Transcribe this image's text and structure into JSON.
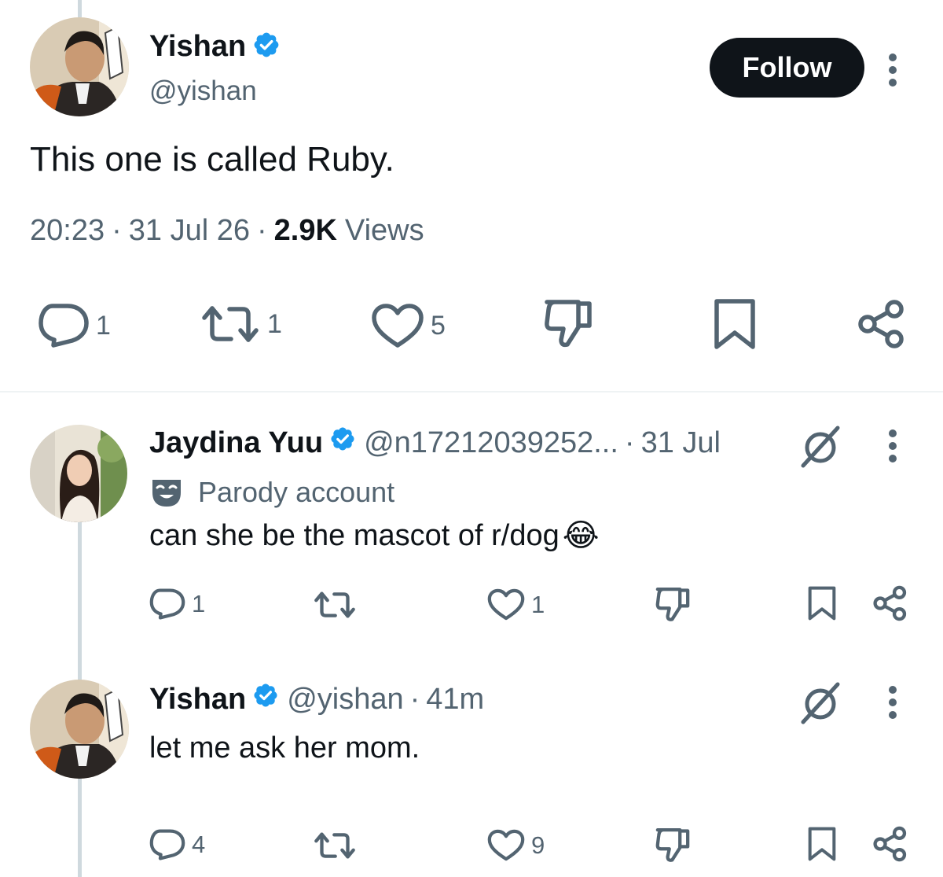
{
  "main_tweet": {
    "display_name": "Yishan",
    "handle": "@yishan",
    "follow_label": "Follow",
    "text": "This one is called Ruby.",
    "time": "20:23",
    "sep1": "·",
    "date": "31 Jul 26",
    "sep2": "·",
    "views_count": "2.9K",
    "views_label": "Views",
    "actions": {
      "replies": "1",
      "reposts": "1",
      "likes": "5"
    }
  },
  "replies": [
    {
      "display_name": "Jaydina Yuu",
      "handle": "@n17212039252...",
      "sep": "·",
      "time": "31 Jul",
      "badge_label": "Parody account",
      "text": "can she be the mascot of r/dog",
      "emoji": "😂",
      "actions": {
        "replies": "1",
        "reposts": "",
        "likes": "1"
      }
    },
    {
      "display_name": "Yishan",
      "handle": "@yishan",
      "sep": "·",
      "time": "41m",
      "text": "let me ask her mom.",
      "actions": {
        "replies": "4",
        "reposts": "",
        "likes": "9"
      }
    }
  ],
  "colors": {
    "text": "#0f1419",
    "muted": "#536471",
    "verified": "#1d9bf0",
    "thread_line": "#cfd9de",
    "follow_bg": "#0f1419"
  },
  "icons": [
    "reply-icon",
    "repost-icon",
    "like-icon",
    "dislike-icon",
    "bookmark-icon",
    "share-icon",
    "grok-icon",
    "more-icon",
    "verified-badge-icon",
    "parody-mask-icon"
  ]
}
